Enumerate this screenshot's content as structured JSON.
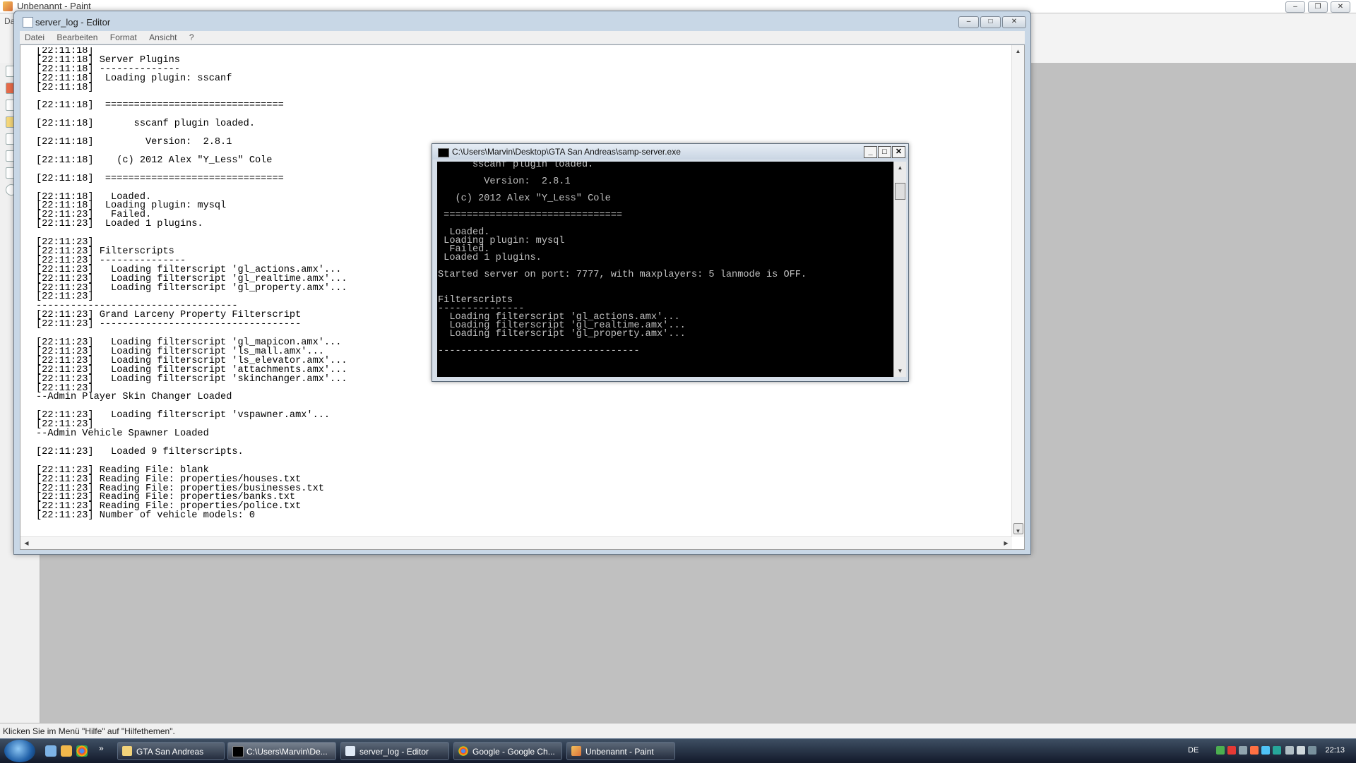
{
  "paint": {
    "title": "Unbenannt - Paint",
    "menu_label": "Da",
    "status_text": "Klicken Sie im Menü \"Hilfe\" auf \"Hilfethemen\"."
  },
  "notepad": {
    "title": "server_log - Editor",
    "menu": [
      "Datei",
      "Bearbeiten",
      "Format",
      "Ansicht",
      "?"
    ],
    "content": "[22:11:18]\n[22:11:18] Server Plugins\n[22:11:18] --------------\n[22:11:18]  Loading plugin: sscanf\n[22:11:18]\n\n[22:11:18]  ===============================\n\n[22:11:18]       sscanf plugin loaded.\n\n[22:11:18]         Version:  2.8.1\n\n[22:11:18]    (c) 2012 Alex \"Y_Less\" Cole\n\n[22:11:18]  ===============================\n\n[22:11:18]   Loaded.\n[22:11:18]  Loading plugin: mysql\n[22:11:23]   Failed.\n[22:11:23]  Loaded 1 plugins.\n\n[22:11:23]\n[22:11:23] Filterscripts\n[22:11:23] ---------------\n[22:11:23]   Loading filterscript 'gl_actions.amx'...\n[22:11:23]   Loading filterscript 'gl_realtime.amx'...\n[22:11:23]   Loading filterscript 'gl_property.amx'...\n[22:11:23]\n-----------------------------------\n[22:11:23] Grand Larceny Property Filterscript\n[22:11:23] -----------------------------------\n\n[22:11:23]   Loading filterscript 'gl_mapicon.amx'...\n[22:11:23]   Loading filterscript 'ls_mall.amx'...\n[22:11:23]   Loading filterscript 'ls_elevator.amx'...\n[22:11:23]   Loading filterscript 'attachments.amx'...\n[22:11:23]   Loading filterscript 'skinchanger.amx'...\n[22:11:23]\n--Admin Player Skin Changer Loaded\n\n[22:11:23]   Loading filterscript 'vspawner.amx'...\n[22:11:23]\n--Admin Vehicle Spawner Loaded\n\n[22:11:23]   Loaded 9 filterscripts.\n\n[22:11:23] Reading File: blank\n[22:11:23] Reading File: properties/houses.txt\n[22:11:23] Reading File: properties/businesses.txt\n[22:11:23] Reading File: properties/banks.txt\n[22:11:23] Reading File: properties/police.txt\n[22:11:23] Number of vehicle models: 0"
  },
  "console": {
    "title": "C:\\Users\\Marvin\\Desktop\\GTA San Andreas\\samp-server.exe",
    "content": "      sscanf plugin loaded.\n\n        Version:  2.8.1\n\n   (c) 2012 Alex \"Y_Less\" Cole\n\n ===============================\n\n  Loaded.\n Loading plugin: mysql\n  Failed.\n Loaded 1 plugins.\n\nStarted server on port: 7777, with maxplayers: 5 lanmode is OFF.\n\n\nFilterscripts\n---------------\n  Loading filterscript 'gl_actions.amx'...\n  Loading filterscript 'gl_realtime.amx'...\n  Loading filterscript 'gl_property.amx'...\n\n-----------------------------------"
  },
  "taskbar": {
    "tasks": [
      {
        "label": "GTA San Andreas",
        "icon": "folder-icon"
      },
      {
        "label": "C:\\Users\\Marvin\\De...",
        "icon": "console-icon"
      },
      {
        "label": "server_log - Editor",
        "icon": "notepad-icon"
      },
      {
        "label": "Google - Google Ch...",
        "icon": "chrome-icon"
      },
      {
        "label": "Unbenannt - Paint",
        "icon": "paint-icon"
      }
    ],
    "language": "DE",
    "clock": "22:13"
  }
}
